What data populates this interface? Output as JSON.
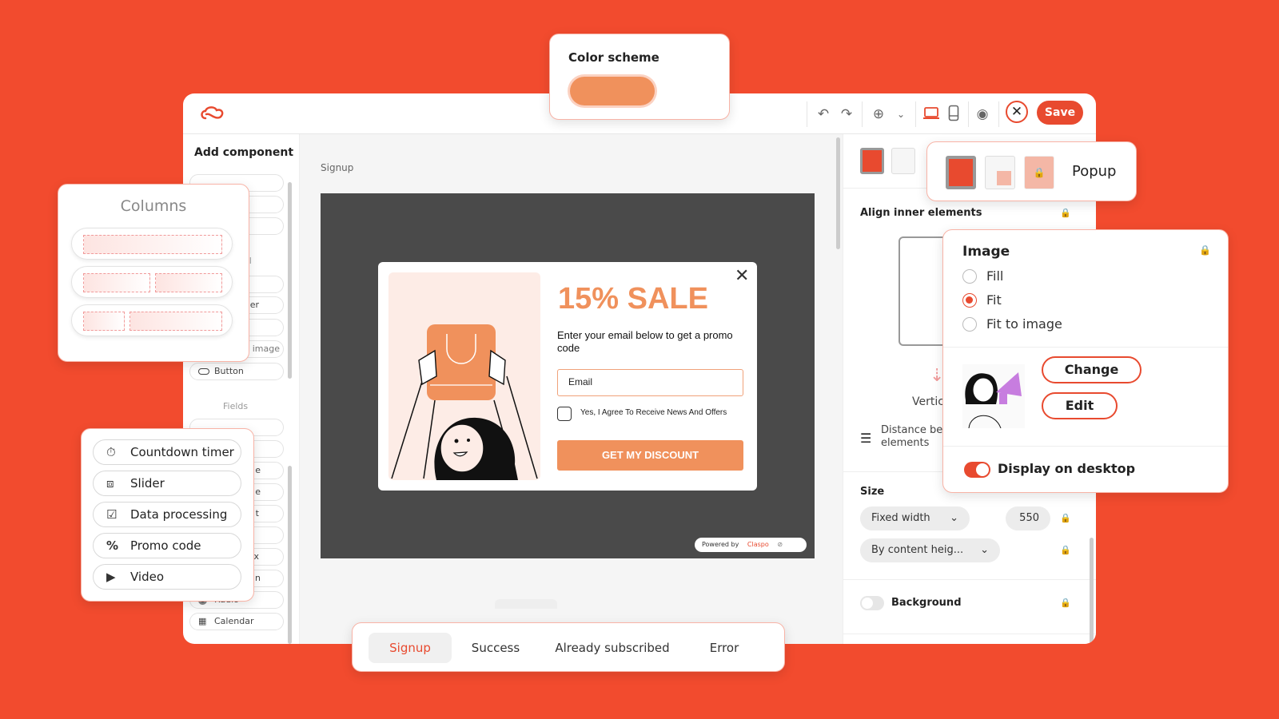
{
  "colors": {
    "background": "#f24b2e",
    "accent": "#e84a2f",
    "popup_orange": "#f0915c"
  },
  "color_scheme": {
    "title": "Color scheme",
    "swatch": "#f0915c"
  },
  "header": {
    "save_label": "Save",
    "icons": [
      "undo-icon",
      "redo-icon",
      "globe-icon",
      "chevron-down-icon",
      "desktop-icon",
      "mobile-icon",
      "eye-icon",
      "close-icon"
    ]
  },
  "sidebar": {
    "title": "Add component",
    "partial_items": [
      "al",
      "er",
      "g image"
    ],
    "button_item": "Button",
    "fields_heading": "Fields",
    "partial_field_items": [
      "e",
      "e",
      "t",
      "x",
      "n"
    ],
    "radio_item": "Radio",
    "calendar_item": "Calendar"
  },
  "columns_card": {
    "title": "Columns"
  },
  "fields_card": {
    "items": [
      {
        "label": "Countdown timer",
        "icon": "timer-icon"
      },
      {
        "label": "Slider",
        "icon": "slider-icon"
      },
      {
        "label": "Data processing",
        "icon": "checkbox-icon"
      },
      {
        "label": "Promo code",
        "icon": "percent-icon"
      },
      {
        "label": "Video",
        "icon": "video-icon"
      }
    ]
  },
  "canvas": {
    "page_label": "Signup"
  },
  "popup_preview": {
    "headline": "15% SALE",
    "subtitle": "Enter your email below to get a promo code",
    "email_placeholder": "Email",
    "consent": "Yes, I Agree To Receive News And Offers",
    "cta": "GET MY DISCOUNT",
    "powered_by": "Powered by",
    "brand": "Claspo"
  },
  "right_panel": {
    "align_title": "Align inner elements",
    "vertical_partial": "Vertic",
    "distance_label": "Distance be elements",
    "distance_line1": "Distance be",
    "distance_line2": "elements",
    "size_title": "Size",
    "width_mode": "Fixed width",
    "width_value": "550",
    "height_mode": "By content heig...",
    "background_label": "Background",
    "background_enabled": false
  },
  "popup_type_card": {
    "label": "Popup"
  },
  "image_card": {
    "title": "Image",
    "options": [
      "Fill",
      "Fit",
      "Fit to image"
    ],
    "selected": "Fit",
    "change_label": "Change",
    "edit_label": "Edit",
    "display_label": "Display on desktop",
    "display_enabled": true
  },
  "bottom_tabs": {
    "tabs": [
      "Signup",
      "Success",
      "Already subscribed",
      "Error"
    ],
    "active": "Signup"
  }
}
